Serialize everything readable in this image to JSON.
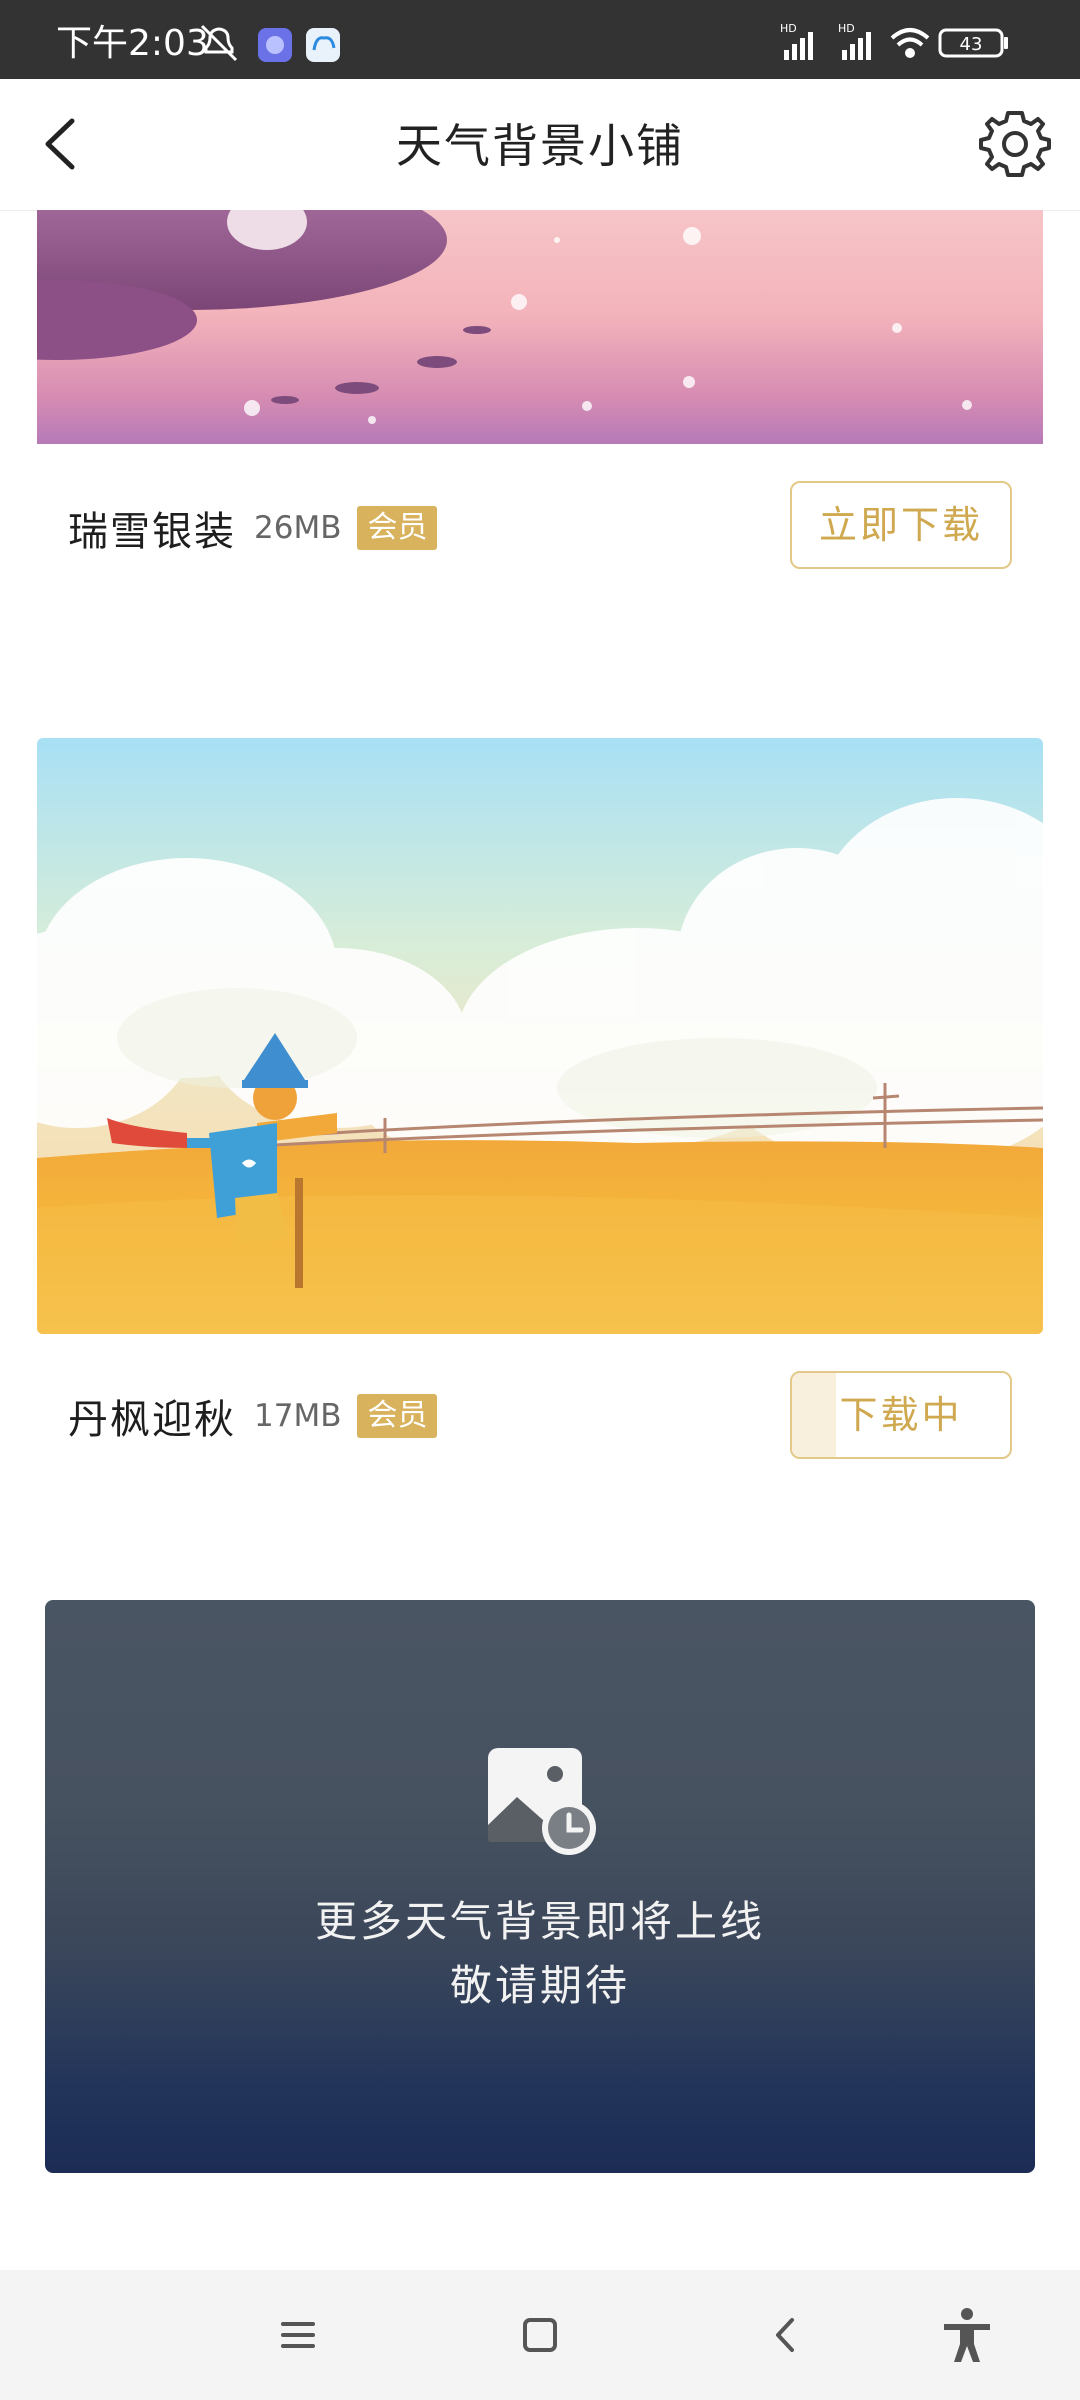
{
  "status_bar": {
    "time": "下午2:03",
    "battery": "43",
    "signal_label_1": "HD",
    "signal_label_2": "HD"
  },
  "header": {
    "title": "天气背景小铺"
  },
  "items": [
    {
      "name": "瑞雪银装",
      "size": "26MB",
      "badge": "会员",
      "action_label": "立即下载"
    },
    {
      "name": "丹枫迎秋",
      "size": "17MB",
      "badge": "会员",
      "action_label": "下载中",
      "progress": 0.2
    }
  ],
  "coming_soon": {
    "line1": "更多天气背景即将上线",
    "line2": "敬请期待"
  },
  "icons": {
    "back": "chevron-left-icon",
    "settings": "gear-icon",
    "nav_menu": "menu-icon",
    "nav_home": "square-icon",
    "nav_back": "back-arrow-icon",
    "accessibility": "accessibility-icon"
  },
  "colors": {
    "accent": "#cfa84f",
    "badge": "#d8b25c"
  }
}
